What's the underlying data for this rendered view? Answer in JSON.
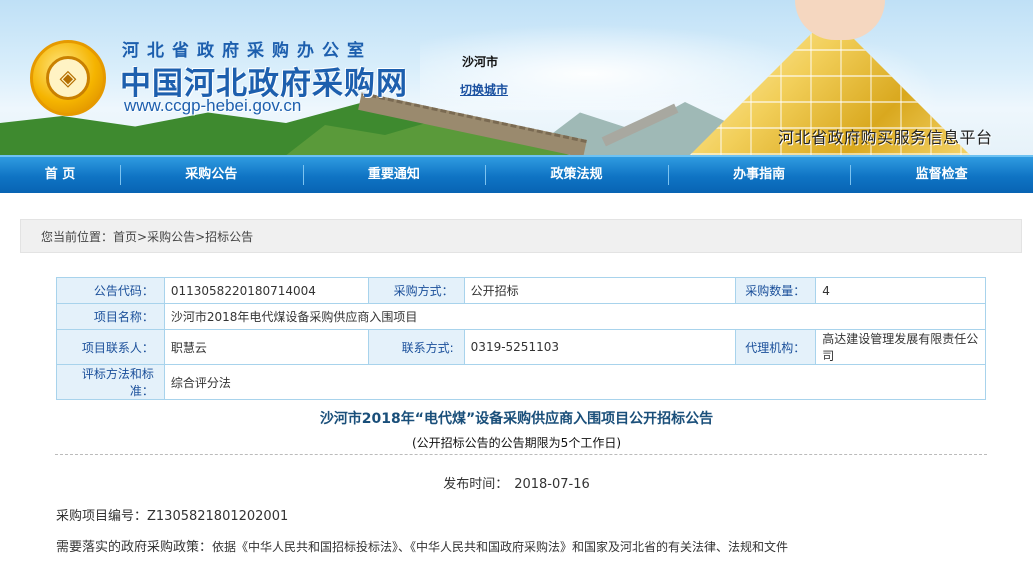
{
  "header": {
    "org_line": "河北省政府采购办公室",
    "site_name": "中国河北政府采购网",
    "site_url": "www.ccgp-hebei.gov.cn",
    "city": "沙河市",
    "switch_city": "切换城市",
    "platform": "河北省政府购买服务信息平台"
  },
  "nav": {
    "items": [
      "首 页",
      "采购公告",
      "重要通知",
      "政策法规",
      "办事指南",
      "监督检查"
    ]
  },
  "breadcrumb": {
    "prefix": "您当前位置：",
    "crumbs": [
      "首页",
      "采购公告",
      "招标公告"
    ],
    "separator": ">"
  },
  "info": {
    "code_label": "公告代码：",
    "code_value": "0113058220180714004",
    "method_label": "采购方式：",
    "method_value": "公开招标",
    "qty_label": "采购数量：",
    "qty_value": "4",
    "project_label": "项目名称：",
    "project_value": "沙河市2018年电代煤设备采购供应商入围项目",
    "contact_label": "项目联系人：",
    "contact_value": "职慧云",
    "phone_label": "联系方式:",
    "phone_value": "0319-5251103",
    "agency_label": "代理机构：",
    "agency_value": "高达建设管理发展有限责任公司",
    "eval_label": "评标方法和标准：",
    "eval_value": "综合评分法"
  },
  "notice": {
    "title": "沙河市2018年“电代煤”设备采购供应商入围项目公开招标公告",
    "subtitle": "(公开招标公告的公告期限为5个工作日)",
    "publish_label": "发布时间：",
    "publish_date": "2018-07-16",
    "project_no": "采购项目编号：Z1305821801202001",
    "policy_lead": "需要落实的政府采购政策：",
    "policy_text": "依据《中华人民共和国招标投标法》、《中华人民共和国政府采购法》和国家及河北省的有关法律、法规和文件"
  }
}
